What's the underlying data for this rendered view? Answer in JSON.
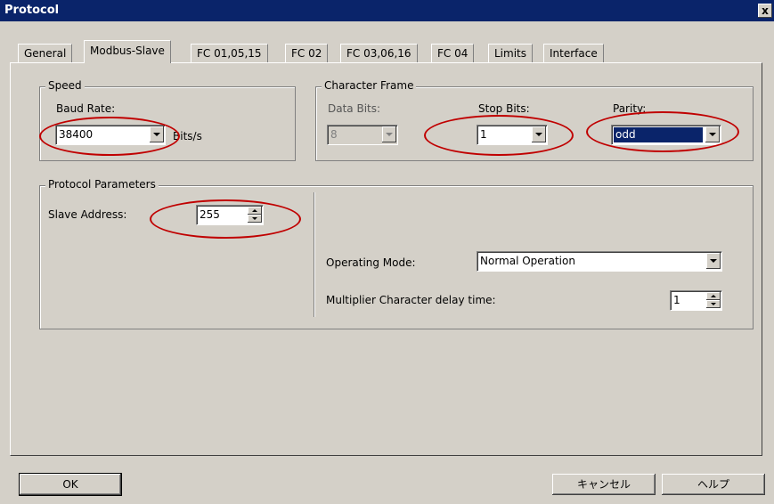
{
  "window": {
    "title": "Protocol",
    "close_glyph": "x"
  },
  "tabs": [
    {
      "label": "General"
    },
    {
      "label": "Modbus-Slave"
    },
    {
      "label": "FC 01,05,15"
    },
    {
      "label": "FC 02"
    },
    {
      "label": "FC 03,06,16"
    },
    {
      "label": "FC 04"
    },
    {
      "label": "Limits"
    },
    {
      "label": "Interface"
    }
  ],
  "speed": {
    "group_label": "Speed",
    "baud_rate_label": "Baud Rate:",
    "baud_rate_value": "38400",
    "units": "Bits/s"
  },
  "character_frame": {
    "group_label": "Character Frame",
    "data_bits_label": "Data Bits:",
    "data_bits_value": "8",
    "stop_bits_label": "Stop Bits:",
    "stop_bits_value": "1",
    "parity_label": "Parity:",
    "parity_value": "odd"
  },
  "protocol_parameters": {
    "group_label": "Protocol Parameters",
    "slave_address_label": "Slave Address:",
    "slave_address_value": "255",
    "operating_mode_label": "Operating Mode:",
    "operating_mode_value": "Normal Operation",
    "multiplier_label": "Multiplier Character delay time:",
    "multiplier_value": "1"
  },
  "buttons": {
    "ok": "OK",
    "cancel": "キャンセル",
    "help": "ヘルプ"
  },
  "colors": {
    "highlight": "#c00000",
    "titlebar": "#0a246a",
    "face": "#d4d0c8"
  }
}
